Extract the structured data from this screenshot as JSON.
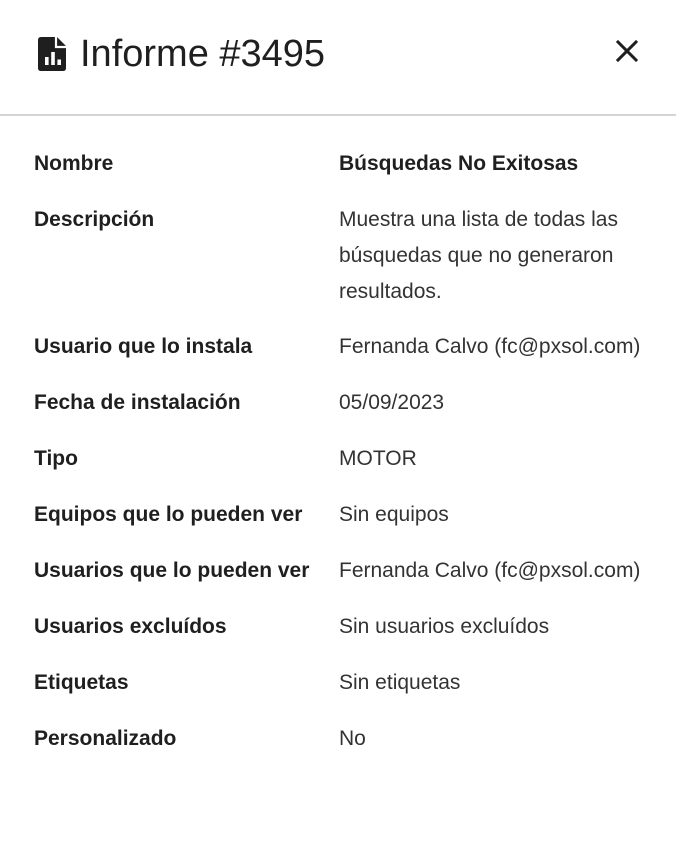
{
  "header": {
    "title": "Informe #3495",
    "icon": "report-file-icon",
    "close_icon": "close-icon"
  },
  "details": [
    {
      "key": "name",
      "label": "Nombre",
      "value": "Búsquedas No Exitosas"
    },
    {
      "key": "description",
      "label": "Descripción",
      "value": "Muestra una lista de todas las búsquedas que no generaron resultados."
    },
    {
      "key": "installer",
      "label": "Usuario que lo instala",
      "value": "Fernanda Calvo (fc@pxsol.com)"
    },
    {
      "key": "install-date",
      "label": "Fecha de instalación",
      "value": "05/09/2023"
    },
    {
      "key": "type",
      "label": "Tipo",
      "value": "MOTOR"
    },
    {
      "key": "teams",
      "label": "Equipos que lo pueden ver",
      "value": "Sin equipos"
    },
    {
      "key": "users",
      "label": "Usuarios que lo pueden ver",
      "value": "Fernanda Calvo (fc@pxsol.com)"
    },
    {
      "key": "excluded-users",
      "label": "Usuarios excluídos",
      "value": "Sin usuarios excluídos"
    },
    {
      "key": "tags",
      "label": "Etiquetas",
      "value": "Sin etiquetas"
    },
    {
      "key": "custom",
      "label": "Personalizado",
      "value": "No"
    }
  ]
}
